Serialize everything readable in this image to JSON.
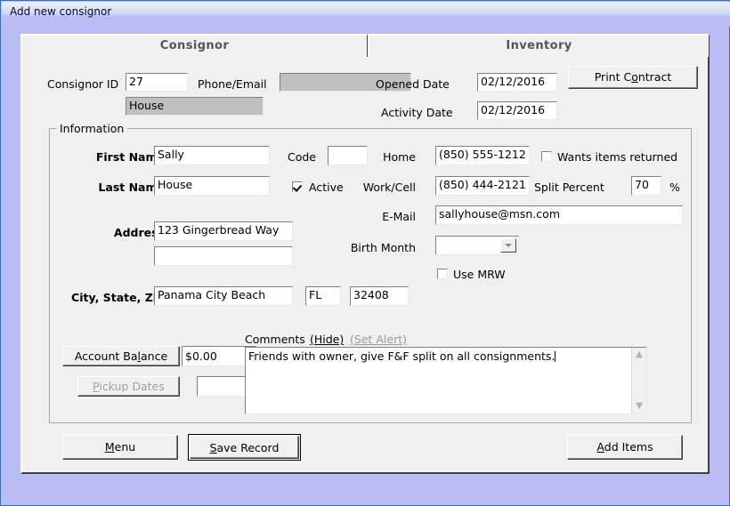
{
  "window": {
    "title": "Add new consignor",
    "accent_border": "#3b6fb6",
    "frame_color": "#b9bcf5",
    "face_color": "#f0f0f0"
  },
  "tabs": [
    {
      "label": "Consignor",
      "selected": true
    },
    {
      "label": "Inventory",
      "selected": false
    }
  ],
  "header": {
    "consignor_id_label": "Consignor ID",
    "consignor_id_value": "27",
    "account_name_value": "House",
    "phone_email_label": "Phone/Email",
    "phone_email_value": "",
    "opened_date_label": "Opened Date",
    "opened_date_value": "02/12/2016",
    "activity_date_label": "Activity Date",
    "activity_date_value": "02/12/2016",
    "print_contract_button": "Print Contract",
    "print_contract_accel": "o"
  },
  "information": {
    "legend": "Information",
    "first_name_label": "First Name",
    "first_name_value": "Sally",
    "last_name_label": "Last Name",
    "last_name_value": "House",
    "address_label": "Address",
    "address_line1_value": "123 Gingerbread Way",
    "address_line2_value": "",
    "city_state_zip_label": "City, State, Zip",
    "city_value": "Panama City Beach",
    "state_value": "FL",
    "zip_value": "32408",
    "code_label": "Code",
    "code_value": "",
    "active_label": "Active",
    "active_checked": true,
    "home_label": "Home",
    "home_value": "(850) 555-1212",
    "work_cell_label": "Work/Cell",
    "work_cell_value": "(850) 444-2121",
    "email_label": "E-Mail",
    "email_value": "sallyhouse@msn.com",
    "birth_month_label": "Birth Month",
    "birth_month_value": "",
    "wants_items_returned_label": "Wants items returned",
    "wants_items_returned_checked": false,
    "split_percent_label": "Split Percent",
    "split_percent_value": "70",
    "percent_symbol": "%",
    "use_mrw_label": "Use MRW",
    "use_mrw_checked": false,
    "account_balance_button": "Account Balance",
    "account_balance_accel": "l",
    "account_balance_value": "$0.00",
    "pickup_dates_button": "Pickup Dates",
    "pickup_dates_accel": "P",
    "pickup_dates_disabled": true,
    "pickup_dates_value": "",
    "comments_label": "Comments",
    "comments_hide_link": "(Hide)",
    "comments_set_alert_link": "(Set Alert)",
    "comments_value": "Friends with owner, give F&F split on all consignments.",
    "scroll_up_glyph": "▲",
    "scroll_down_glyph": "▼"
  },
  "footer": {
    "menu_button": "Menu",
    "menu_accel": "M",
    "save_record_button": "Save Record",
    "save_record_accel": "S",
    "add_items_button": "Add Items",
    "add_items_accel": "A"
  }
}
